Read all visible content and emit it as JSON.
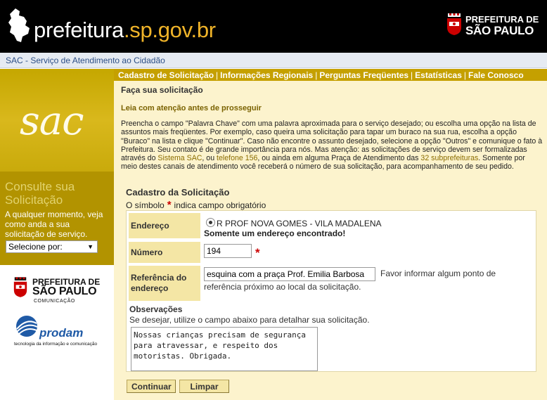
{
  "header": {
    "site_name_main": "prefeitura",
    "site_name_accent": ".sp.gov.br",
    "logo_line1": "PREFEITURA DE",
    "logo_line2": "SÃO PAULO"
  },
  "subheader": {
    "title": "SAC - Serviço de Atendimento ao Cidadão"
  },
  "sidebar": {
    "sac_label": "sac",
    "consulte_title": "Consulte sua Solicitação",
    "consulte_desc": "A qualquer momento, veja como anda a sua solicitação de serviço.",
    "select_value": "Selecione por:",
    "logo_line1": "PREFEITURA DE",
    "logo_line2": "SÃO PAULO",
    "logo_line3": "COMUNICAÇÃO",
    "prodam_name": "prodam",
    "prodam_tagline": "tecnologia da informação e comunicação"
  },
  "nav": {
    "items": [
      "Cadastro de Solicitação",
      "Informações Regionais",
      "Perguntas Freqüentes",
      "Estatísticas",
      "Fale Conosco"
    ],
    "separator": "|"
  },
  "content": {
    "heading": "Faça sua solicitação",
    "subheading": "Leia com atenção antes de prosseguir",
    "intro_p1": "Preencha o campo \"Palavra Chave\" com uma palavra aproximada para o serviço desejado; ou escolha uma opção na lista de assuntos mais freqüentes. Por exemplo, caso queira uma solicitação para tapar um buraco na sua rua, escolha a opção \"Buraco\" na lista e clique \"Continuar\". Caso não encontre o assunto desejado, selecione a opção \"Outros\" e comunique o fato à Prefeitura. Seu contato é de grande importância para nós. Mas atenção: as solicitações de serviço devem ser formalizadas através do ",
    "link_sac": "Sistema SAC",
    "intro_p2": ", ou ",
    "link_phone": "telefone 156",
    "intro_p3": ", ou ainda em alguma Praça de Atendimento das ",
    "link_subpref": "32 subprefeituras",
    "intro_p4": ". Somente por meio destes canais de atendimento você receberá o número de sua solicitação, para acompanhamento de seu pedido."
  },
  "form": {
    "title": "Cadastro da Solicitação",
    "note_before": "O símbolo",
    "required_symbol": "*",
    "note_after": "indica campo obrigatório",
    "endereco_label": "Endereço",
    "endereco_value": "R PROF NOVA GOMES - VILA MADALENA",
    "endereco_found": "Somente um endereço encontrado!",
    "numero_label": "Número",
    "numero_value": "194",
    "referencia_label": "Referência do endereço",
    "referencia_value": "esquina com a praça Prof. Emilia Barbosa",
    "referencia_hint1": "Favor informar algum ponto de",
    "referencia_hint2": "referência próximo ao local da solicitação.",
    "obs_label": "Observações",
    "obs_hint": "Se desejar, utilize o campo abaixo para detalhar sua solicitação.",
    "obs_value": "Nossas crianças precisam de segurança para atravessar, e respeito dos motoristas. Obrigada.",
    "btn_continue": "Continuar",
    "btn_clear": "Limpar"
  },
  "colors": {
    "header_bg": "#000000",
    "accent_orange": "#f0b429",
    "nav_bg": "#c5a000",
    "content_bg": "#fcf3cd",
    "label_bg": "#f4e6a5",
    "required_red": "#cc0000"
  }
}
